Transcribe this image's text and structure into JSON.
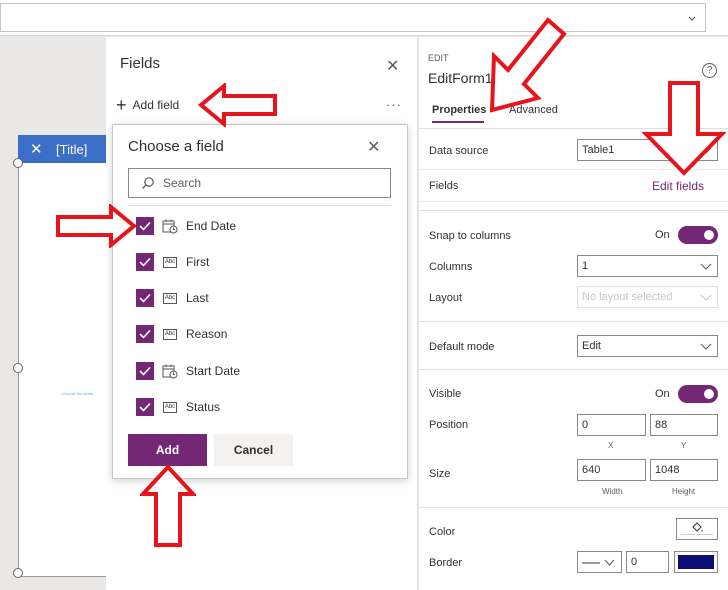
{
  "canvas": {
    "form_header_title": "[Title]",
    "form_close_icon": "close-icon",
    "form_hint": "Choose the fields"
  },
  "fields_pane": {
    "title": "Fields",
    "add_field_label": "Add field",
    "more_icon": "more-icon",
    "close_icon": "close-icon"
  },
  "chooser": {
    "title": "Choose a field",
    "search_placeholder": "Search",
    "fields": [
      {
        "label": "End Date",
        "type": "date-icon",
        "checked": true
      },
      {
        "label": "First",
        "type": "text-icon",
        "checked": true
      },
      {
        "label": "Last",
        "type": "text-icon",
        "checked": true
      },
      {
        "label": "Reason",
        "type": "text-icon",
        "checked": true
      },
      {
        "label": "Start Date",
        "type": "date-icon",
        "checked": true
      },
      {
        "label": "Status",
        "type": "text-icon",
        "checked": true
      }
    ],
    "abc_glyph": "Abc",
    "add_label": "Add",
    "cancel_label": "Cancel"
  },
  "properties": {
    "edit_label": "EDIT",
    "control_name": "EditForm1",
    "help_glyph": "?",
    "tabs": [
      "Properties",
      "Advanced"
    ],
    "data_source_label": "Data source",
    "data_source_value": "Table1",
    "fields_label": "Fields",
    "edit_fields_link": "Edit fields",
    "snap_label": "Snap to columns",
    "snap_value": "On",
    "columns_label": "Columns",
    "columns_value": "1",
    "layout_label": "Layout",
    "layout_value": "No layout selected",
    "default_mode_label": "Default mode",
    "default_mode_value": "Edit",
    "visible_label": "Visible",
    "visible_value": "On",
    "position_label": "Position",
    "position_x": "0",
    "position_y": "88",
    "x_label": "X",
    "y_label": "Y",
    "size_label": "Size",
    "size_width": "640",
    "size_height": "1048",
    "width_label": "Width",
    "height_label": "Height",
    "color_label": "Color",
    "border_label": "Border",
    "border_width": "0",
    "border_color": "#0b0e74"
  },
  "colors": {
    "accent": "#742774",
    "form_header": "#3b6fc7",
    "annotation_arrow": "#e8141b"
  }
}
